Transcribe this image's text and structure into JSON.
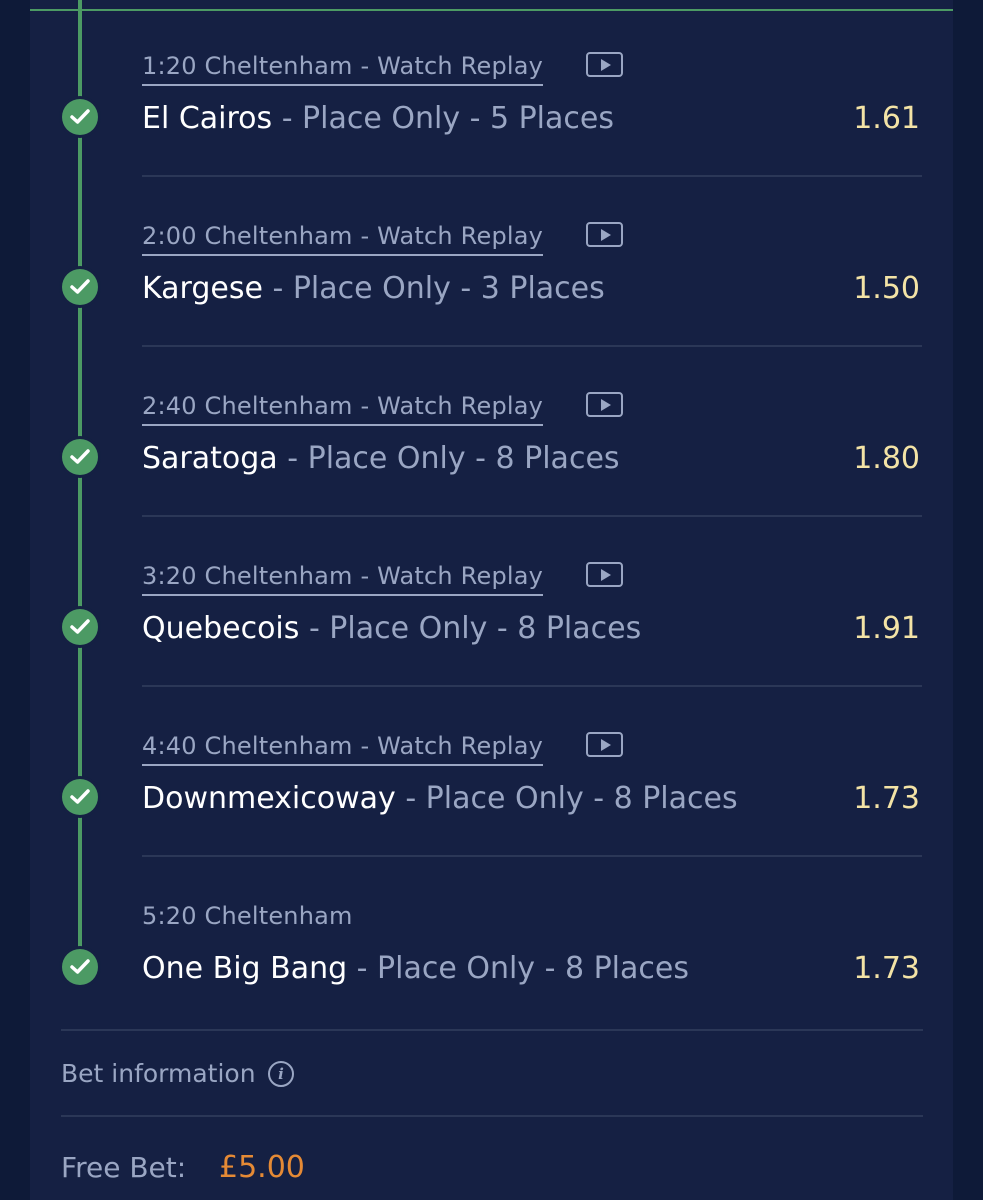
{
  "legs": [
    {
      "race": "1:20 Cheltenham - Watch Replay",
      "replay": true,
      "horse": "El Cairos",
      "market": " - Place Only - 5 Places",
      "odds": "1.61"
    },
    {
      "race": "2:00 Cheltenham - Watch Replay",
      "replay": true,
      "horse": "Kargese",
      "market": " - Place Only - 3 Places",
      "odds": "1.50"
    },
    {
      "race": "2:40 Cheltenham - Watch Replay",
      "replay": true,
      "horse": "Saratoga",
      "market": " - Place Only - 8 Places",
      "odds": "1.80"
    },
    {
      "race": "3:20 Cheltenham - Watch Replay",
      "replay": true,
      "horse": "Quebecois",
      "market": " - Place Only - 8 Places",
      "odds": "1.91"
    },
    {
      "race": "4:40 Cheltenham - Watch Replay",
      "replay": true,
      "horse": "Downmexicoway",
      "market": " - Place Only - 8 Places",
      "odds": "1.73"
    },
    {
      "race": "5:20 Cheltenham",
      "replay": false,
      "horse": "One Big Bang",
      "market": " - Place Only - 8 Places",
      "odds": "1.73"
    }
  ],
  "bet_info": {
    "label": "Bet information",
    "icon": "info-icon"
  },
  "free_bet": {
    "label": "Free Bet:",
    "amount": "£5.00"
  },
  "colors": {
    "success": "#4c9a64",
    "odds": "#f3e3a6",
    "amount": "#e58a35",
    "background": "#152043"
  }
}
